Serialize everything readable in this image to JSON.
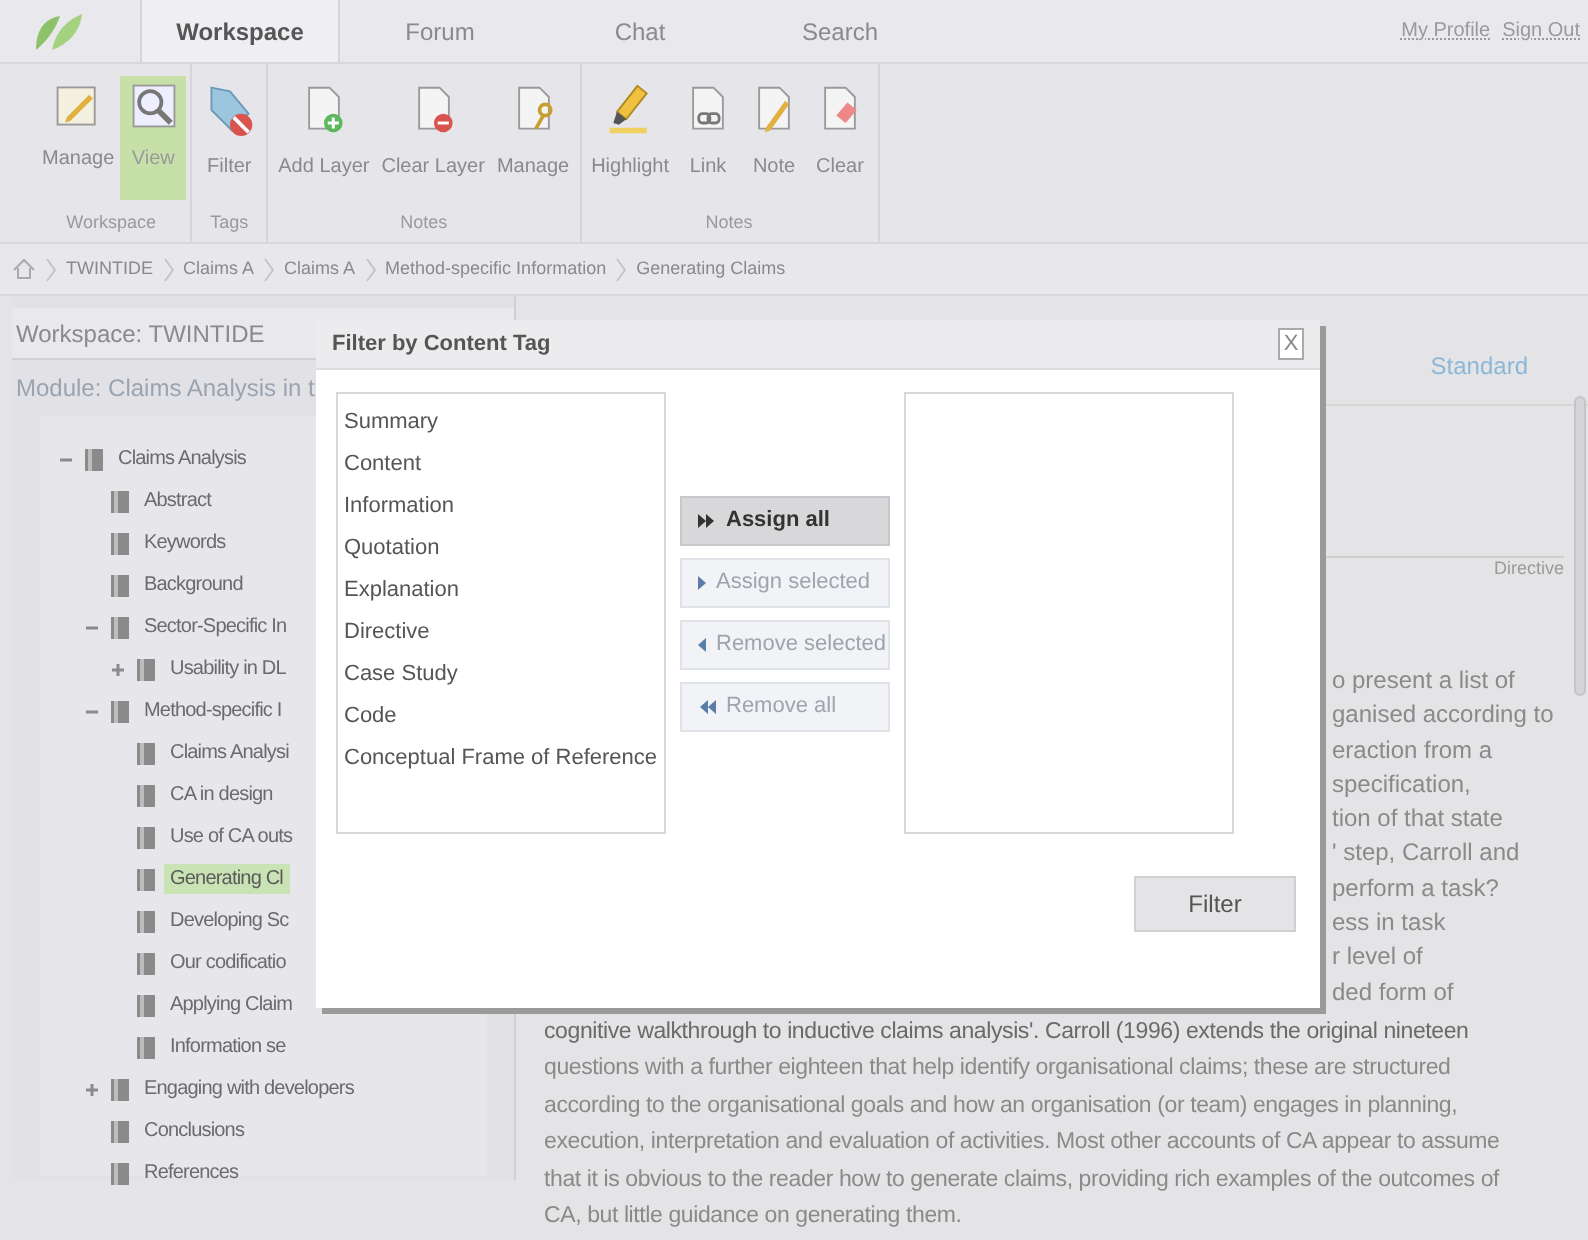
{
  "top_tabs": [
    {
      "label": "Workspace",
      "selected": true
    },
    {
      "label": "Forum",
      "selected": false
    },
    {
      "label": "Chat",
      "selected": false
    },
    {
      "label": "Search",
      "selected": false
    }
  ],
  "user_links": [
    "My Profile",
    "Sign Out"
  ],
  "ribbon_groups": [
    {
      "label": "Workspace",
      "buttons": [
        {
          "label": "Manage",
          "kind": "edit",
          "selected": false
        },
        {
          "label": "View",
          "kind": "view",
          "selected": true
        }
      ]
    },
    {
      "label": "Tags",
      "buttons": [
        {
          "label": "Filter",
          "kind": "tag",
          "selected": false
        }
      ]
    },
    {
      "label": "Notes",
      "buttons": [
        {
          "label": "Add Layer",
          "kind": "add",
          "selected": false
        },
        {
          "label": "Clear Layer",
          "kind": "remove",
          "selected": false
        },
        {
          "label": "Manage",
          "kind": "key",
          "selected": false
        }
      ]
    },
    {
      "label": "Notes",
      "buttons": [
        {
          "label": "Highlight",
          "kind": "highlight",
          "selected": false
        },
        {
          "label": "Link",
          "kind": "link",
          "selected": false
        },
        {
          "label": "Note",
          "kind": "note",
          "selected": false
        },
        {
          "label": "Clear",
          "kind": "erase",
          "selected": false
        }
      ]
    }
  ],
  "breadcrumb": [
    "TWINTIDE",
    "Claims A",
    "Claims A",
    "Method-specific Information",
    "Generating Claims"
  ],
  "sidebar": {
    "workspace_title": "Workspace: TWINTIDE",
    "module_title": "Module: Claims Analysis in t",
    "tree": [
      {
        "label": "Claims Analysis",
        "expanded": true,
        "selected": false,
        "children": [
          {
            "label": "Abstract",
            "selected": false
          },
          {
            "label": "Keywords",
            "selected": false
          },
          {
            "label": "Background",
            "selected": false
          },
          {
            "label": "Sector-Specific In",
            "expanded": true,
            "selected": false,
            "children": [
              {
                "label": "Usability in DL",
                "expanded": false,
                "selected": false
              }
            ]
          },
          {
            "label": "Method-specific I",
            "expanded": true,
            "selected": false,
            "children": [
              {
                "label": "Claims Analysi",
                "selected": false
              },
              {
                "label": "CA in design",
                "selected": false
              },
              {
                "label": "Use of CA outs",
                "selected": false
              },
              {
                "label": "Generating Cl",
                "selected": true
              },
              {
                "label": "Developing Sc",
                "selected": false
              },
              {
                "label": "Our codificatio",
                "selected": false
              },
              {
                "label": "Applying Claim",
                "selected": false
              },
              {
                "label": "Information se",
                "selected": false
              }
            ]
          },
          {
            "label": "Engaging with developers",
            "expanded": false,
            "selected": false
          },
          {
            "label": "Conclusions",
            "selected": false
          },
          {
            "label": "References",
            "selected": false
          }
        ]
      }
    ]
  },
  "content": {
    "view_tab": "Standard",
    "tag_label": "Directive",
    "partial_lines": [
      "o present a list of",
      "ganised according to",
      "eraction from a",
      "specification,",
      "tion of that state",
      "' step, Carroll and",
      "perform a task?",
      "ess in task",
      "r level of",
      "ded form of"
    ],
    "lines": [
      "cognitive walkthrough to inductive claims analysis'. Carroll (1996) extends the original nineteen",
      "questions with a further eighteen that help identify organisational claims; these are structured",
      "according to the organisational goals and how an organisation (or team) engages in planning,",
      "execution, interpretation and evaluation of activities. Most other accounts of CA appear to assume",
      "that it is obvious to the reader how to generate claims, providing rich examples of the outcomes of",
      "CA, but little guidance on generating them."
    ]
  },
  "dialog": {
    "title": "Filter by Content Tag",
    "close": "X",
    "available_tags": [
      "Summary",
      "Content",
      "Information",
      "Quotation",
      "Explanation",
      "Directive",
      "Case Study",
      "Code",
      "Conceptual Frame of Reference"
    ],
    "move_buttons": [
      {
        "label": "Assign all",
        "kind": "assign_all",
        "disabled": false
      },
      {
        "label": "Assign selected",
        "kind": "assign",
        "disabled": true
      },
      {
        "label": "Remove selected",
        "kind": "remove",
        "disabled": true
      },
      {
        "label": "Remove all",
        "kind": "remove_all",
        "disabled": true
      }
    ],
    "filter_button": "Filter"
  }
}
